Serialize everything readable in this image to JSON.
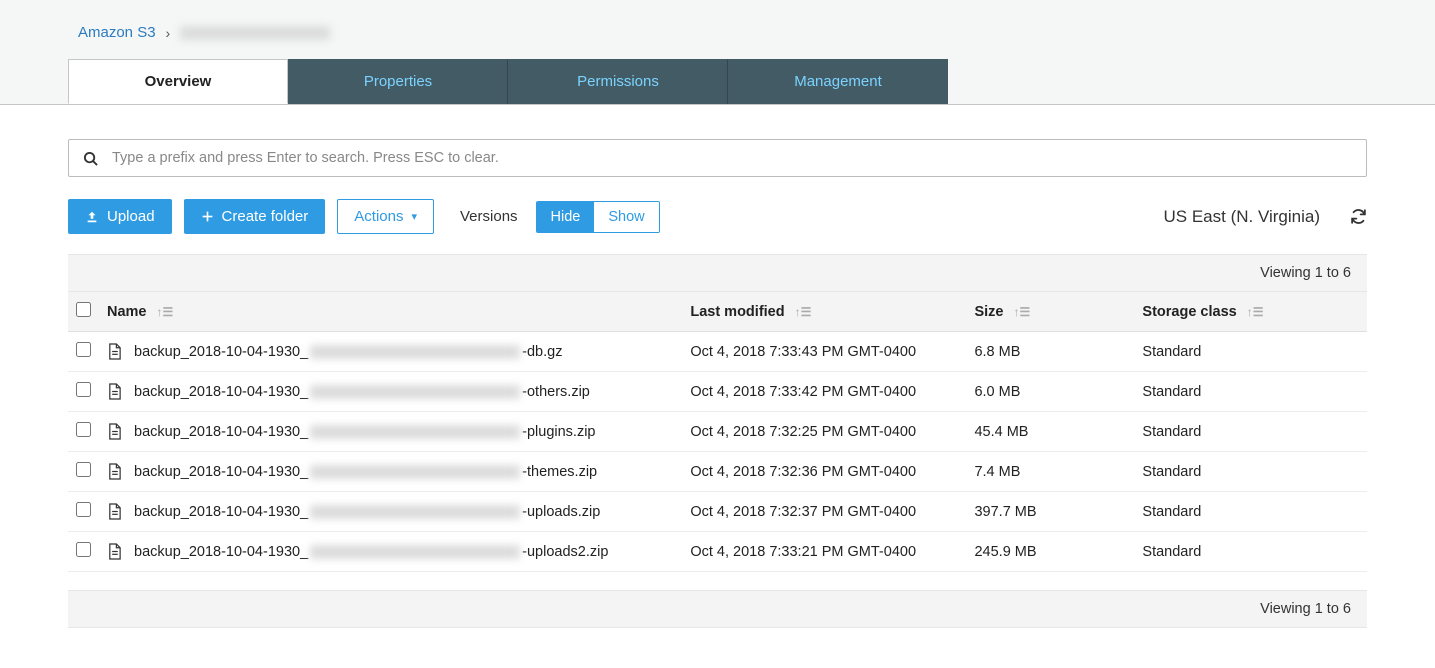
{
  "breadcrumb": {
    "root": "Amazon S3"
  },
  "tabs": {
    "overview": "Overview",
    "properties": "Properties",
    "permissions": "Permissions",
    "management": "Management"
  },
  "search": {
    "placeholder": "Type a prefix and press Enter to search. Press ESC to clear."
  },
  "toolbar": {
    "upload": "Upload",
    "create_folder": "Create folder",
    "actions": "Actions",
    "versions_label": "Versions",
    "hide": "Hide",
    "show": "Show"
  },
  "region": "US East (N. Virginia)",
  "viewing_top": "Viewing 1 to 6",
  "viewing_bottom": "Viewing 1 to 6",
  "columns": {
    "name": "Name",
    "last_modified": "Last modified",
    "size": "Size",
    "storage_class": "Storage class"
  },
  "rows": [
    {
      "name_prefix": "backup_2018-10-04-1930_",
      "name_suffix": "-db.gz",
      "last_modified": "Oct 4, 2018 7:33:43 PM GMT-0400",
      "size": "6.8 MB",
      "storage_class": "Standard"
    },
    {
      "name_prefix": "backup_2018-10-04-1930_",
      "name_suffix": "-others.zip",
      "last_modified": "Oct 4, 2018 7:33:42 PM GMT-0400",
      "size": "6.0 MB",
      "storage_class": "Standard"
    },
    {
      "name_prefix": "backup_2018-10-04-1930_",
      "name_suffix": "-plugins.zip",
      "last_modified": "Oct 4, 2018 7:32:25 PM GMT-0400",
      "size": "45.4 MB",
      "storage_class": "Standard"
    },
    {
      "name_prefix": "backup_2018-10-04-1930_",
      "name_suffix": "-themes.zip",
      "last_modified": "Oct 4, 2018 7:32:36 PM GMT-0400",
      "size": "7.4 MB",
      "storage_class": "Standard"
    },
    {
      "name_prefix": "backup_2018-10-04-1930_",
      "name_suffix": "-uploads.zip",
      "last_modified": "Oct 4, 2018 7:32:37 PM GMT-0400",
      "size": "397.7 MB",
      "storage_class": "Standard"
    },
    {
      "name_prefix": "backup_2018-10-04-1930_",
      "name_suffix": "-uploads2.zip",
      "last_modified": "Oct 4, 2018 7:33:21 PM GMT-0400",
      "size": "245.9 MB",
      "storage_class": "Standard"
    }
  ]
}
